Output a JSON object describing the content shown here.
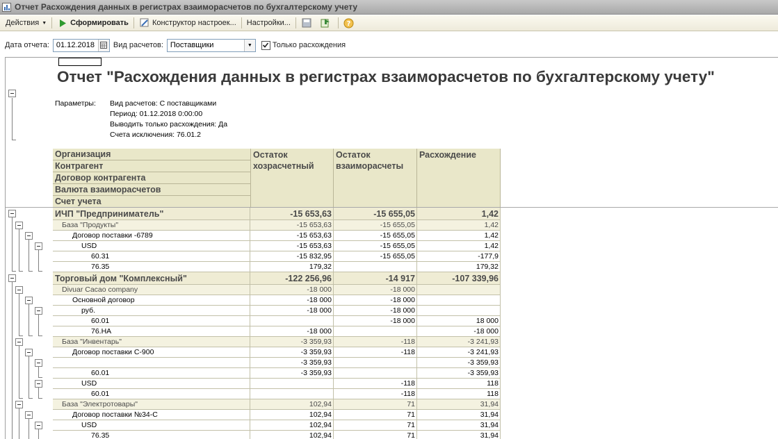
{
  "window": {
    "title": "Отчет  Расхождения данных в регистрах взаиморасчетов по бухгалтерскому учету"
  },
  "toolbar": {
    "actions": "Действия",
    "generate": "Сформировать",
    "constructor": "Конструктор настроек...",
    "settings": "Настройки...",
    "icons": [
      "save-icon",
      "export-icon",
      "help-icon"
    ]
  },
  "params": {
    "date_label": "Дата отчета:",
    "date_value": "01.12.2018",
    "calc_label": "Вид расчетов:",
    "calc_value": "Поставщики",
    "only_diff_label": "Только расхождения",
    "only_diff_checked": true
  },
  "report": {
    "title": "Отчет \"Расхождения данных в регистрах взаиморасчетов по бухгалтерскому учету\"",
    "params_label": "Параметры:",
    "params": [
      "Вид расчетов: С поставщиками",
      "Период: 01.12.2018 0:00:00",
      "Выводить только расхождения: Да",
      "Счета исключения: 76.01.2"
    ],
    "header": {
      "group_levels": [
        "Организация",
        "Контрагент",
        "Договор контрагента",
        "Валюта взаиморасчетов",
        "Счет учета"
      ],
      "col1": "Остаток хозрасчетный",
      "col2": "Остаток взаиморасчеты",
      "col3": "Расхождение"
    },
    "rows": [
      {
        "label": "ИЧП \"Предприниматель\"",
        "v1": "-15 653,63",
        "v2": "-15 655,05",
        "v3": "1,42",
        "level": 0,
        "kind": "top"
      },
      {
        "label": "База \"Продукты\"",
        "v1": "-15 653,63",
        "v2": "-15 655,05",
        "v3": "1,42",
        "level": 1,
        "kind": "grp"
      },
      {
        "label": "Договор поставки -6789",
        "v1": "-15 653,63",
        "v2": "-15 655,05",
        "v3": "1,42",
        "level": 2,
        "kind": "row"
      },
      {
        "label": "USD",
        "v1": "-15 653,63",
        "v2": "-15 655,05",
        "v3": "1,42",
        "level": 3,
        "kind": "row"
      },
      {
        "label": "60.31",
        "v1": "-15 832,95",
        "v2": "-15 655,05",
        "v3": "-177,9",
        "level": 4,
        "kind": "row"
      },
      {
        "label": "76.35",
        "v1": "179,32",
        "v2": "",
        "v3": "179,32",
        "level": 4,
        "kind": "row"
      },
      {
        "label": "Торговый дом \"Комплексный\"",
        "v1": "-122 256,96",
        "v2": "-14 917",
        "v3": "-107 339,96",
        "level": 0,
        "kind": "top"
      },
      {
        "label": "Divuar Cacao company",
        "v1": "-18 000",
        "v2": "-18 000",
        "v3": "",
        "level": 1,
        "kind": "grp"
      },
      {
        "label": "Основной договор",
        "v1": "-18 000",
        "v2": "-18 000",
        "v3": "",
        "level": 2,
        "kind": "row"
      },
      {
        "label": "руб.",
        "v1": "-18 000",
        "v2": "-18 000",
        "v3": "",
        "level": 3,
        "kind": "row"
      },
      {
        "label": "60.01",
        "v1": "",
        "v2": "-18 000",
        "v3": "18 000",
        "level": 4,
        "kind": "row"
      },
      {
        "label": "76.НА",
        "v1": "-18 000",
        "v2": "",
        "v3": "-18 000",
        "level": 4,
        "kind": "row"
      },
      {
        "label": "База \"Инвентарь\"",
        "v1": "-3 359,93",
        "v2": "-118",
        "v3": "-3 241,93",
        "level": 1,
        "kind": "grp"
      },
      {
        "label": "Договор поставки С-900",
        "v1": "-3 359,93",
        "v2": "-118",
        "v3": "-3 241,93",
        "level": 2,
        "kind": "row"
      },
      {
        "label": "",
        "v1": "-3 359,93",
        "v2": "",
        "v3": "-3 359,93",
        "level": 3,
        "kind": "row"
      },
      {
        "label": "60.01",
        "v1": "-3 359,93",
        "v2": "",
        "v3": "-3 359,93",
        "level": 4,
        "kind": "row"
      },
      {
        "label": "USD",
        "v1": "",
        "v2": "-118",
        "v3": "118",
        "level": 3,
        "kind": "row"
      },
      {
        "label": "60.01",
        "v1": "",
        "v2": "-118",
        "v3": "118",
        "level": 4,
        "kind": "row"
      },
      {
        "label": "База \"Электротовары\"",
        "v1": "102,94",
        "v2": "71",
        "v3": "31,94",
        "level": 1,
        "kind": "grp"
      },
      {
        "label": "Договор поставки №34-С",
        "v1": "102,94",
        "v2": "71",
        "v3": "31,94",
        "level": 2,
        "kind": "row"
      },
      {
        "label": "USD",
        "v1": "102,94",
        "v2": "71",
        "v3": "31,94",
        "level": 3,
        "kind": "row"
      },
      {
        "label": "76.35",
        "v1": "102,94",
        "v2": "71",
        "v3": "31,94",
        "level": 4,
        "kind": "row"
      }
    ]
  }
}
